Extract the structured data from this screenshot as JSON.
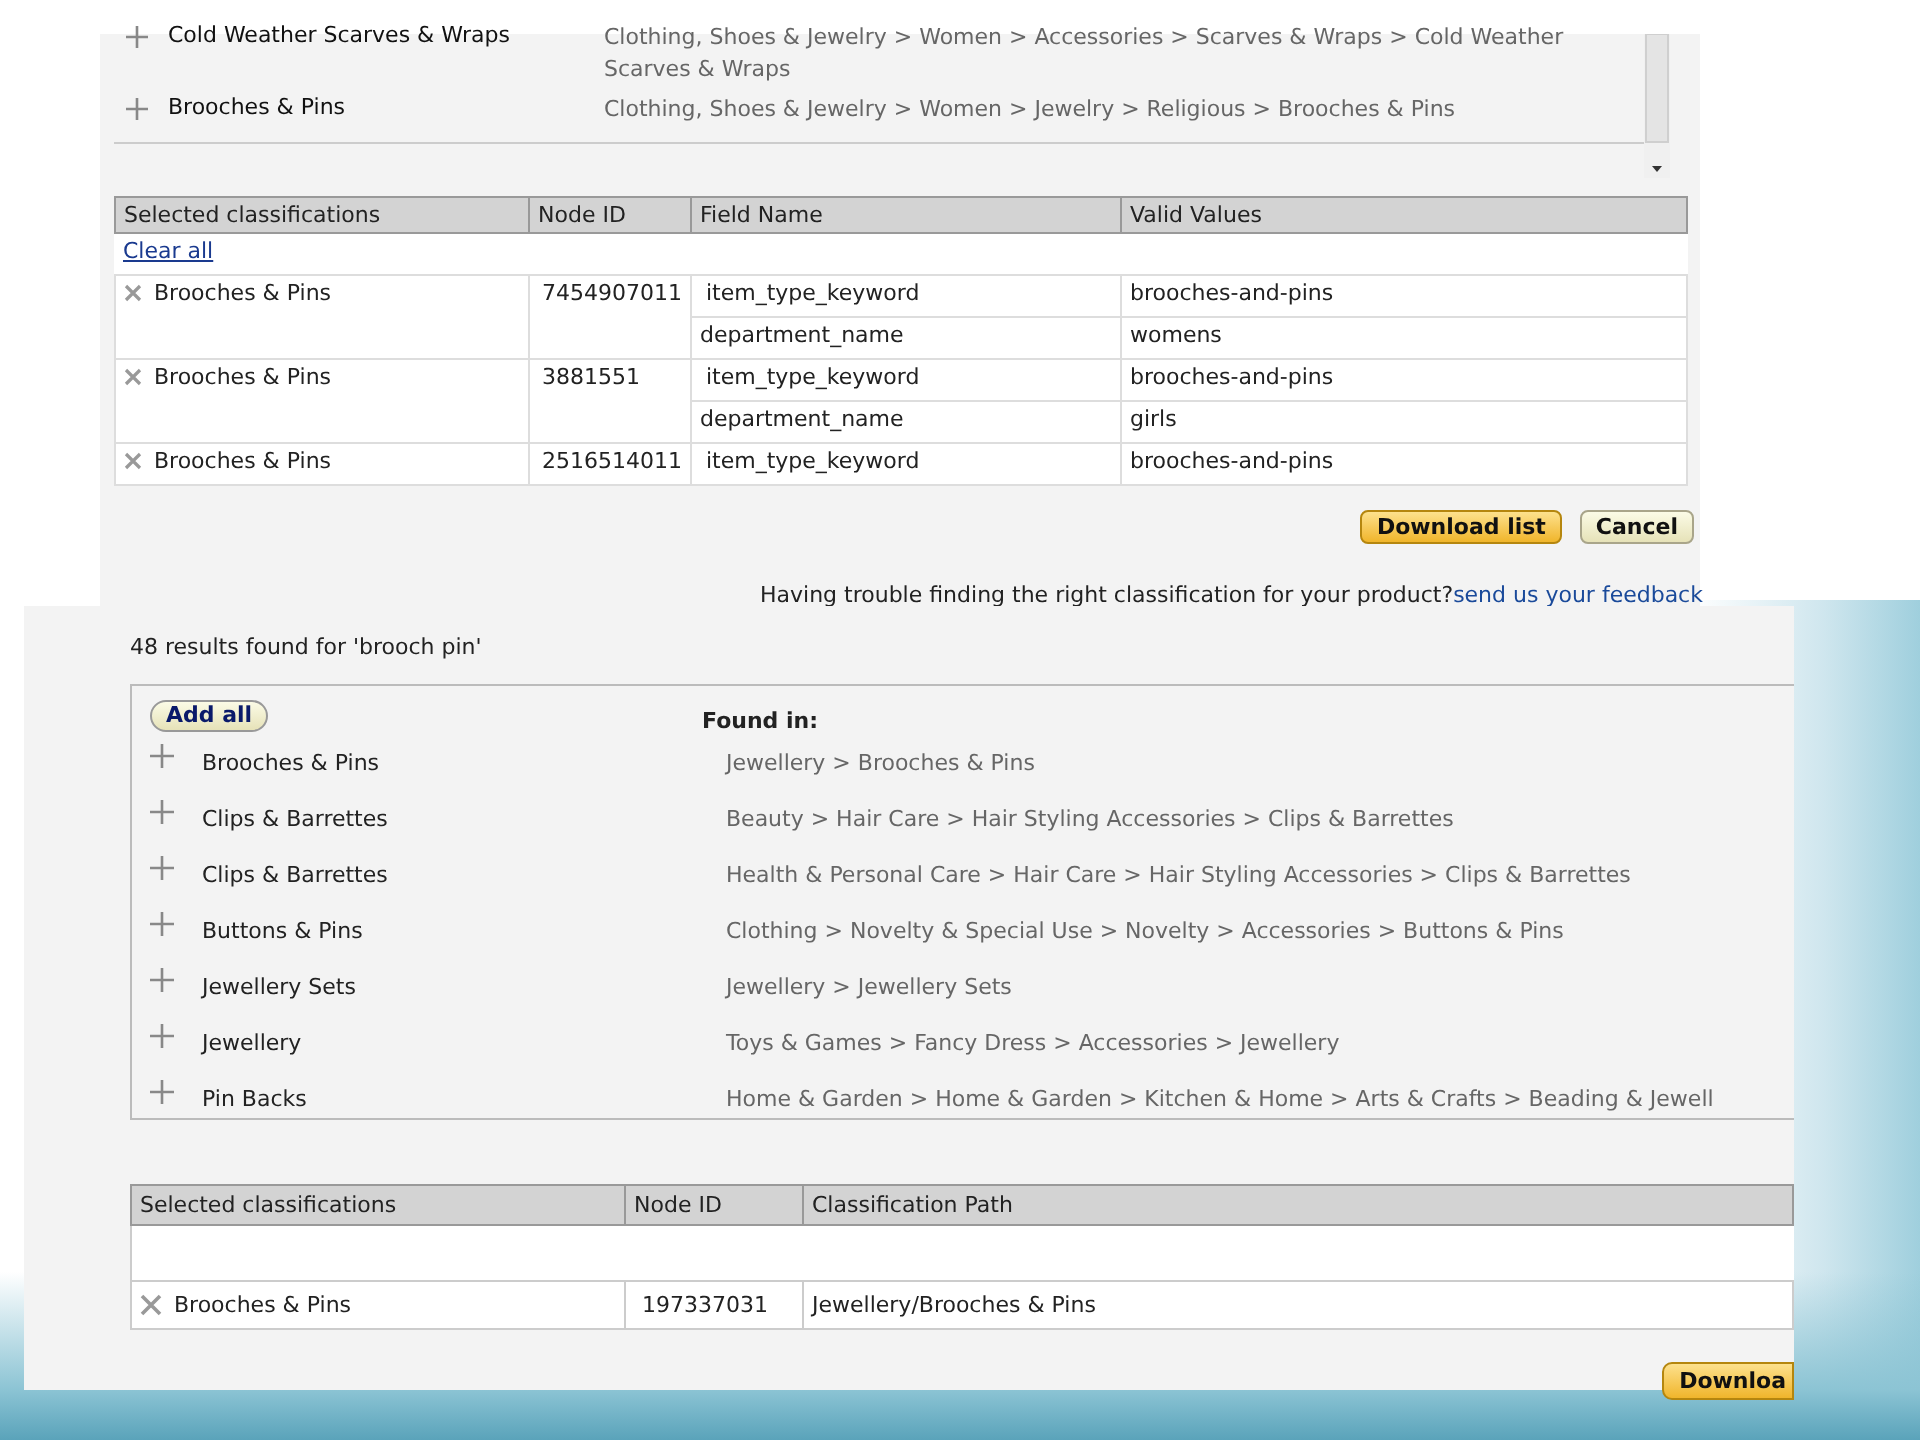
{
  "top_panel": {
    "results": [
      {
        "name": "Cold Weather Scarves & Wraps",
        "path": "Clothing, Shoes & Jewelry > Women > Accessories > Scarves & Wraps > Cold Weather Scarves & Wraps"
      },
      {
        "name": "Brooches & Pins",
        "path": "Clothing, Shoes & Jewelry > Women > Jewelry > Religious > Brooches & Pins"
      }
    ],
    "selected": {
      "columns": [
        "Selected classifications",
        "Node ID",
        "Field Name",
        "Valid Values"
      ],
      "clear_all": "Clear all",
      "rows": [
        {
          "name": "Brooches & Pins",
          "node_id": "7454907011",
          "fields": [
            {
              "field": "item_type_keyword",
              "value": "brooches-and-pins"
            },
            {
              "field": "department_name",
              "value": "womens"
            }
          ]
        },
        {
          "name": "Brooches & Pins",
          "node_id": "3881551",
          "fields": [
            {
              "field": "item_type_keyword",
              "value": "brooches-and-pins"
            },
            {
              "field": "department_name",
              "value": "girls"
            }
          ]
        },
        {
          "name": "Brooches & Pins",
          "node_id": "2516514011",
          "fields": [
            {
              "field": "item_type_keyword",
              "value": "brooches-and-pins"
            }
          ]
        }
      ]
    },
    "buttons": [
      {
        "label": "Download list",
        "kind": "primary"
      },
      {
        "label": "Cancel",
        "kind": "secondary"
      }
    ],
    "feedback": {
      "text": "Having trouble finding the right classification for your product?",
      "link": "send us your feedback"
    }
  },
  "bottom_panel": {
    "summary": "48 results found for 'brooch pin'",
    "add_all": "Add all",
    "found_in_label": "Found in:",
    "results": [
      {
        "name": "Brooches & Pins",
        "path": "Jewellery > Brooches & Pins"
      },
      {
        "name": "Clips & Barrettes",
        "path": "Beauty > Hair Care > Hair Styling Accessories > Clips & Barrettes"
      },
      {
        "name": "Clips & Barrettes",
        "path": "Health & Personal Care > Hair Care > Hair Styling Accessories > Clips & Barrettes"
      },
      {
        "name": "Buttons & Pins",
        "path": "Clothing > Novelty & Special Use > Novelty > Accessories > Buttons & Pins"
      },
      {
        "name": "Jewellery Sets",
        "path": "Jewellery > Jewellery Sets"
      },
      {
        "name": "Jewellery",
        "path": "Toys & Games > Fancy Dress > Accessories > Jewellery"
      },
      {
        "name": "Pin Backs",
        "path": "Home & Garden > Home & Garden > Kitchen & Home > Arts & Crafts > Beading & Jewell"
      }
    ],
    "selected": {
      "columns": [
        "Selected classifications",
        "Node ID",
        "Classification Path"
      ],
      "rows": [
        {
          "name": "Brooches & Pins",
          "node_id": "197337031",
          "path": "Jewellery/Brooches & Pins"
        }
      ]
    },
    "button": "Downloa"
  }
}
